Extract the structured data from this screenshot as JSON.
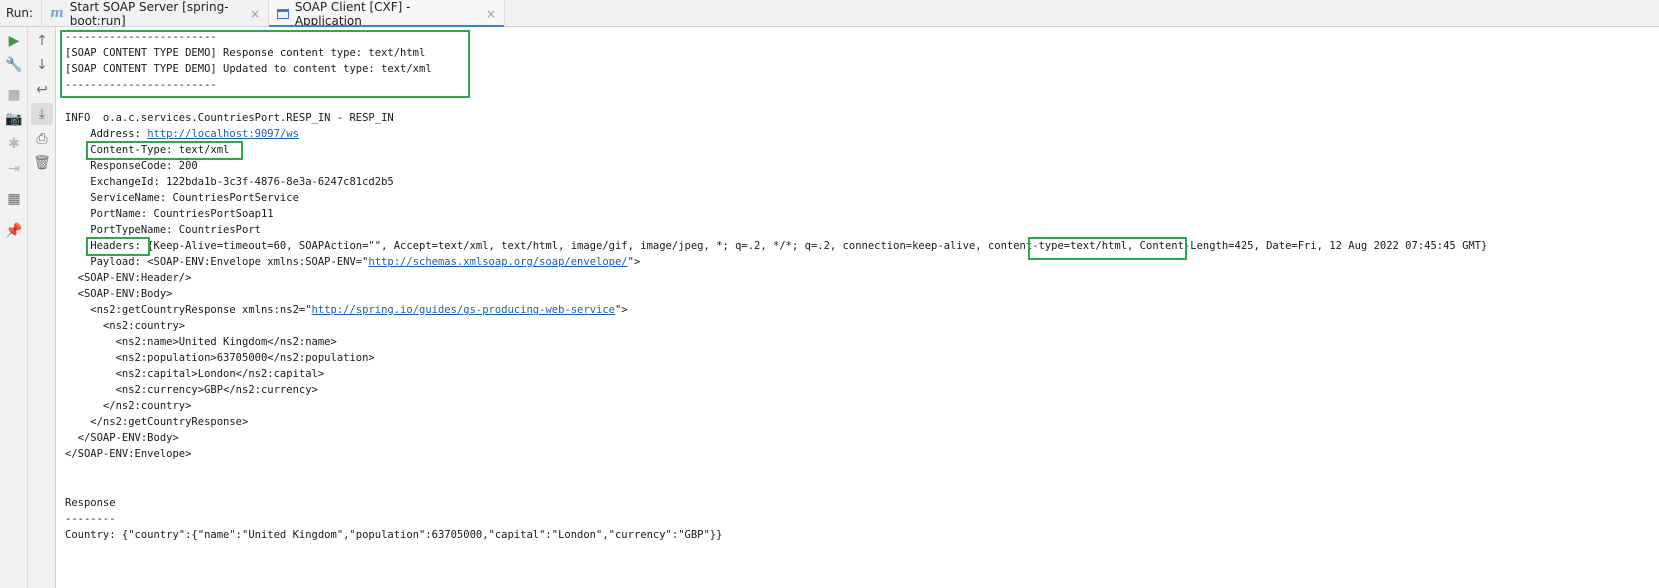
{
  "run_label": "Run:",
  "tabs": [
    {
      "icon": "maven-icon",
      "label": "Start SOAP Server [spring-boot:run]",
      "close": "×",
      "active": false
    },
    {
      "icon": "console-icon",
      "label": "SOAP Client [CXF] - Application",
      "close": "×",
      "active": true
    }
  ],
  "toolbar_left": [
    {
      "icon": "run-icon",
      "glyph": "▶"
    },
    {
      "icon": "wrench-icon",
      "glyph": "🔧"
    },
    {
      "icon": "stop-icon",
      "glyph": "■"
    },
    {
      "icon": "camera-icon",
      "glyph": "📷"
    },
    {
      "icon": "debug-icon",
      "glyph": "✱"
    },
    {
      "icon": "login-icon",
      "glyph": "⇥"
    },
    {
      "icon": "layout-icon",
      "glyph": "▦"
    },
    {
      "icon": "pin-icon",
      "glyph": "📌"
    }
  ],
  "toolbar_right": [
    {
      "icon": "arrow-up-icon",
      "glyph": "↑"
    },
    {
      "icon": "arrow-down-icon",
      "glyph": "↓"
    },
    {
      "icon": "soft-wrap-icon",
      "glyph": "↩"
    },
    {
      "icon": "scroll-to-end-icon",
      "glyph": "⤓"
    },
    {
      "icon": "print-icon",
      "glyph": "⎙"
    },
    {
      "icon": "trash-icon",
      "glyph": "🗑"
    }
  ],
  "console": {
    "sep1": "------------------------",
    "demo1": "[SOAP CONTENT TYPE DEMO] Response content type: text/html",
    "demo2": "[SOAP CONTENT TYPE DEMO] Updated to content type: text/xml",
    "sep2": "------------------------",
    "info": "INFO  o.a.c.services.CountriesPort.RESP_IN - RESP_IN",
    "address_label": "    Address: ",
    "address_url": "http://localhost:9097/ws",
    "content_type": "    Content-Type: text/xml",
    "response_code": "    ResponseCode: 200",
    "exchange_id": "    ExchangeId: 122bda1b-3c3f-4876-8e3a-6247c81cd2b5",
    "service_name": "    ServiceName: CountriesPortService",
    "port_name": "    PortName: CountriesPortSoap11",
    "port_type_name": "    PortTypeName: CountriesPort",
    "headers_pre": "    Headers: {Keep-Alive=timeout=60, SOAPAction=\"\", Accept=text/xml, text/html, image/gif, image/jpeg, *; q=.2, */*; q=.2, connection=keep-alive, ",
    "headers_ct": "content-type=text/html,",
    "headers_post": " Content-Length=425, Date=Fri, 12 Aug 2022 07:45:45 GMT}",
    "payload_pre": "    Payload: <SOAP-ENV:Envelope xmlns:SOAP-ENV=\"",
    "payload_url": "http://schemas.xmlsoap.org/soap/envelope/",
    "payload_post": "\">",
    "x1": "  <SOAP-ENV:Header/>",
    "x2": "  <SOAP-ENV:Body>",
    "x3_pre": "    <ns2:getCountryResponse xmlns:ns2=\"",
    "x3_url": "http://spring.io/guides/gs-producing-web-service",
    "x3_post": "\">",
    "x4": "      <ns2:country>",
    "x5": "        <ns2:name>United Kingdom</ns2:name>",
    "x6": "        <ns2:population>63705000</ns2:population>",
    "x7": "        <ns2:capital>London</ns2:capital>",
    "x8": "        <ns2:currency>GBP</ns2:currency>",
    "x9": "      </ns2:country>",
    "x10": "    </ns2:getCountryResponse>",
    "x11": "  </SOAP-ENV:Body>",
    "x12": "</SOAP-ENV:Envelope>",
    "response_title": "Response",
    "response_sep": "--------",
    "country_line": "Country: {\"country\":{\"name\":\"United Kingdom\",\"population\":63705000,\"capital\":\"London\",\"currency\":\"GBP\"}}"
  },
  "colors": {
    "highlight": "#2ea84a",
    "link": "#1b5fb5",
    "tab_active_underline": "#4083c9"
  }
}
